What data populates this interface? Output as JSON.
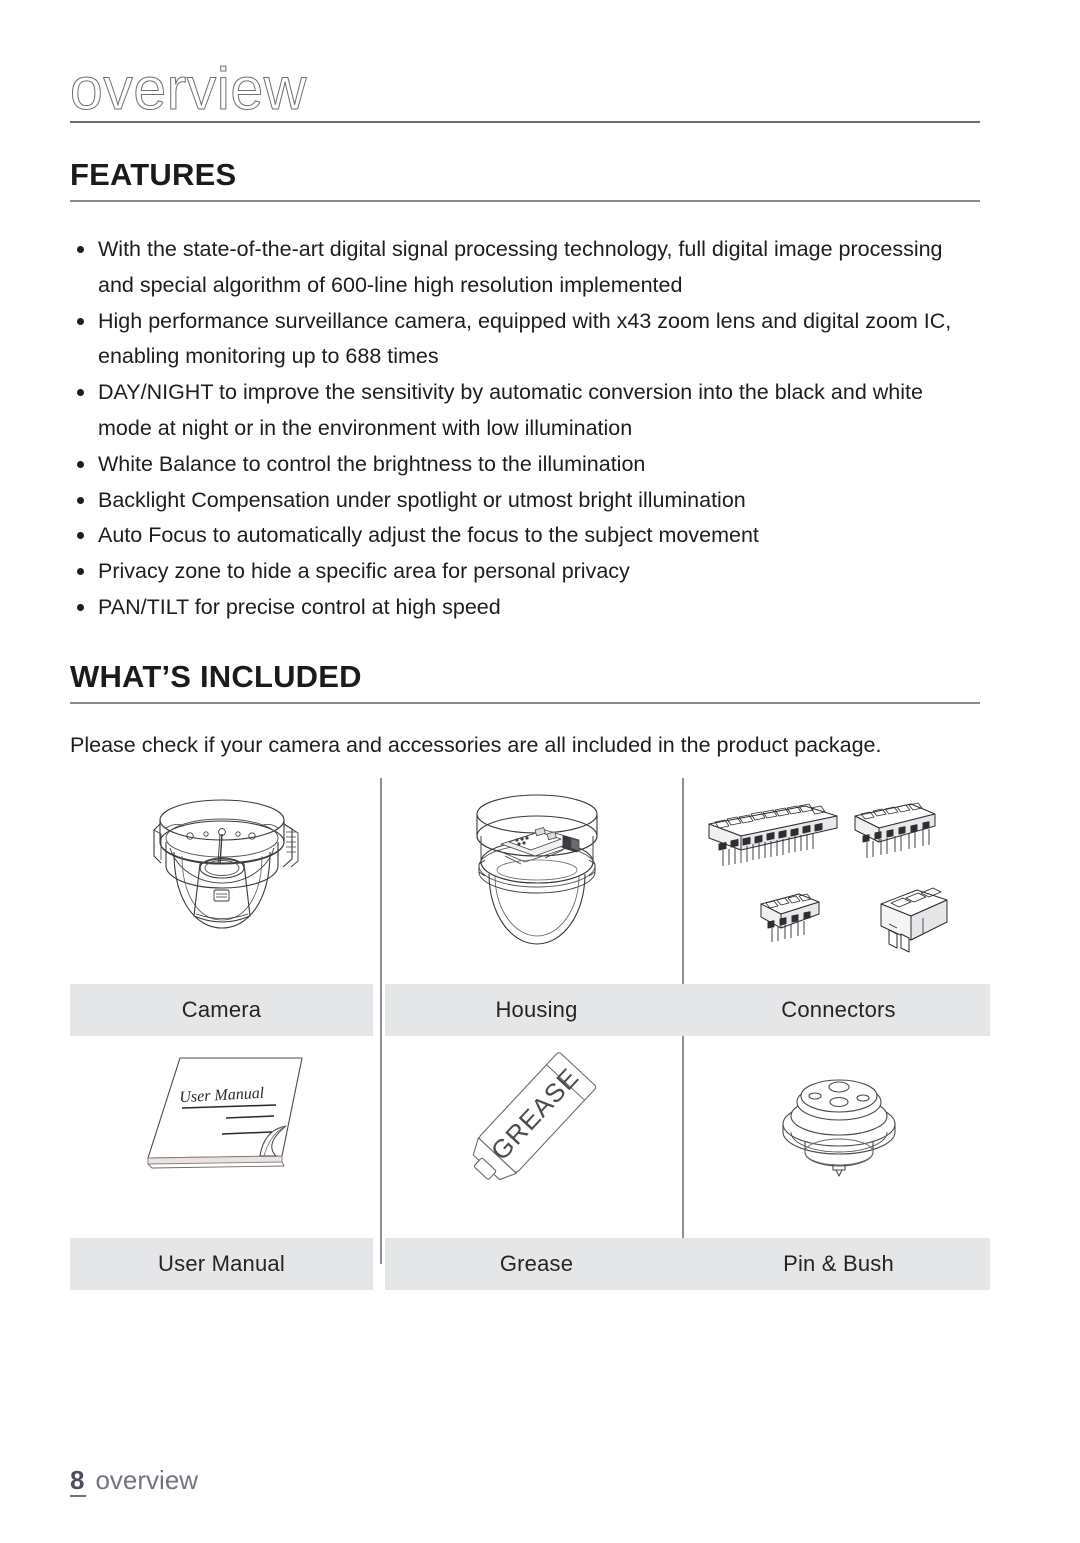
{
  "running_head": {
    "title": "overview"
  },
  "sections": {
    "features": {
      "heading": "FEATURES",
      "items": [
        "With the state-of-the-art digital signal processing technology, full digital image processing and special algorithm of 600-line high resolution implemented",
        "High performance surveillance camera, equipped with x43 zoom lens and digital zoom IC, enabling monitoring up to 688 times",
        "DAY/NIGHT to improve the sensitivity by automatic conversion into the black and white mode at night or in the environment with low illumination",
        "White Balance to control the brightness to the illumination",
        "Backlight Compensation under spotlight or utmost bright illumination",
        "Auto Focus to automatically adjust the focus to the subject movement",
        "Privacy zone to hide a specific area for personal privacy",
        "PAN/TILT for precise control at high speed"
      ]
    },
    "whats_included": {
      "heading": "WHAT’S INCLUDED",
      "intro": "Please check if your camera and accessories are all included in the product package.",
      "items": [
        {
          "caption": "Camera",
          "icon": "dome-camera-icon"
        },
        {
          "caption": "Housing",
          "icon": "camera-housing-icon"
        },
        {
          "caption": "Connectors",
          "icon": "terminal-connectors-icon"
        },
        {
          "caption": "User Manual",
          "icon": "user-manual-icon",
          "cover_title": "User Manual"
        },
        {
          "caption": "Grease",
          "icon": "grease-tube-icon",
          "tube_label": "GREASE"
        },
        {
          "caption": "Pin & Bush",
          "icon": "pin-and-bush-icon"
        }
      ]
    }
  },
  "footer": {
    "page_number": "8",
    "label": "overview"
  },
  "colors": {
    "caption_bar": "#e5e6e8",
    "rule": "#8a8a8d",
    "divider": "#8d8d99",
    "text": "#1d1d1d",
    "footer_text": "#71757f"
  }
}
